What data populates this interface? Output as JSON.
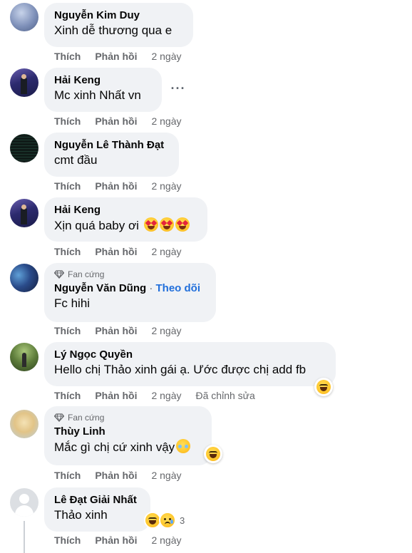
{
  "common": {
    "like": "Thích",
    "reply": "Phản hồi"
  },
  "comments": [
    {
      "name": "Nguyễn Kim Duy",
      "text": "Xinh dễ thương qua e",
      "time": "2 ngày"
    },
    {
      "name": "Hải Keng",
      "text": "Mc xinh Nhất vn",
      "time": "2 ngày",
      "more": "···"
    },
    {
      "name": "Nguyễn Lê Thành Đạt",
      "text": "cmt đầu",
      "time": "2 ngày"
    },
    {
      "name": "Hải Keng",
      "text": "Xịn quá baby ơi",
      "time": "2 ngày",
      "emojis": [
        "heart-eyes",
        "heart-eyes",
        "heart-eyes"
      ]
    },
    {
      "badge": "Fan cứng",
      "name": "Nguyễn Văn Dũng",
      "dot": "·",
      "follow": "Theo dõi",
      "text": "Fc hihi",
      "time": "2 ngày"
    },
    {
      "name": "Lý Ngọc Quyền",
      "text": "Hello chị Thảo xinh gái ạ. Ước được chị add fb",
      "time": "2 ngày",
      "edited": "Đã chỉnh sửa",
      "reaction": "laugh"
    },
    {
      "badge": "Fan cứng",
      "name": "Thùy Linh",
      "text": "Mắc gì chị cứ xinh vậy",
      "time": "2 ngày",
      "reaction": "laugh"
    },
    {
      "name": "Lê Đạt Giải Nhất",
      "text": "Thảo xinh",
      "time": "2 ngày",
      "reactions": [
        "laugh",
        "sad"
      ],
      "reaction_count": "3"
    }
  ]
}
